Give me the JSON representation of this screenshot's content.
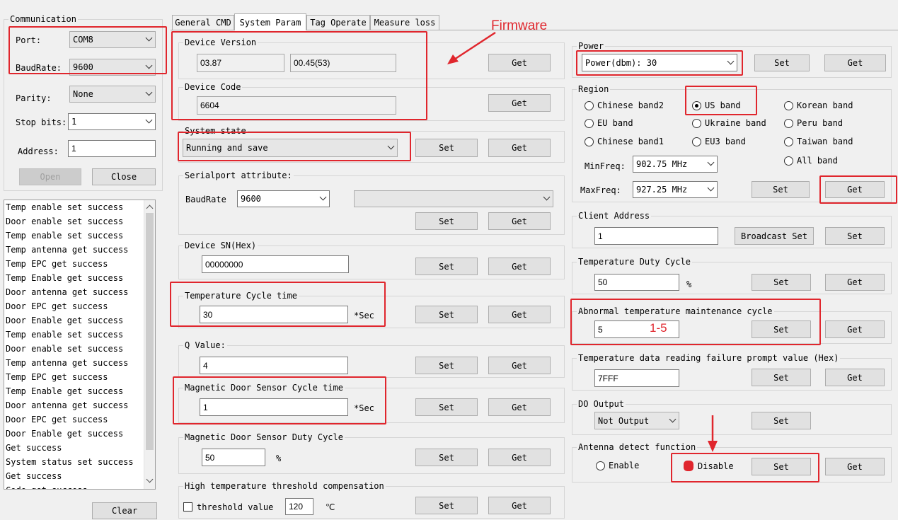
{
  "communication": {
    "title": "Communication",
    "port_label": "Port:",
    "port_value": "COM8",
    "baud_label": "BaudRate:",
    "baud_value": "9600",
    "parity_label": "Parity:",
    "parity_value": "None",
    "stopbits_label": "Stop bits:",
    "stopbits_value": "1",
    "address_label": "Address:",
    "address_value": "1",
    "open_label": "Open",
    "close_label": "Close"
  },
  "log": {
    "lines": [
      "Temp enable set success",
      "Door enable set success",
      "Temp enable set success",
      "Temp antenna get success",
      "Temp EPC get success",
      "Temp Enable get success",
      "Door antenna get success",
      "Door EPC get success",
      "Door Enable get success",
      "Temp enable set success",
      "Door enable set success",
      "Temp antenna get success",
      "Temp EPC get success",
      "Temp Enable get success",
      "Door antenna get success",
      "Door EPC get success",
      "Door Enable get success",
      "Get success",
      "System status set success",
      "Get success",
      "Code get success"
    ],
    "clear_label": "Clear"
  },
  "tabs": [
    "General CMD",
    "System Param",
    "Tag Operate",
    "Measure loss"
  ],
  "params": {
    "device_version": {
      "title": "Device Version",
      "value1": "03.87",
      "value2": "00.45(53)",
      "get": "Get"
    },
    "device_code": {
      "title": "Device Code",
      "value": "6604",
      "get": "Get"
    },
    "system_state": {
      "title": "System state",
      "value": "Running and save",
      "set": "Set",
      "get": "Get"
    },
    "serialport": {
      "title": "Serialport attribute:",
      "baud_label": "BaudRate",
      "baud_value": "9600",
      "other_value": "",
      "set": "Set",
      "get": "Get"
    },
    "device_sn": {
      "title": "Device SN(Hex)",
      "value": "00000000",
      "set": "Set",
      "get": "Get"
    },
    "temp_cycle": {
      "title": "Temperature Cycle time",
      "value": "30",
      "unit": "*Sec",
      "set": "Set",
      "get": "Get"
    },
    "q_value": {
      "title": "Q Value:",
      "value": "4",
      "set": "Set",
      "get": "Get"
    },
    "door_cycle": {
      "title": "Magnetic Door Sensor Cycle time",
      "value": "1",
      "unit": "*Sec",
      "set": "Set",
      "get": "Get"
    },
    "door_duty": {
      "title": "Magnetic Door Sensor Duty Cycle",
      "value": "50",
      "unit": "%",
      "set": "Set",
      "get": "Get"
    },
    "high_temp": {
      "title": "High temperature threshold compensation",
      "check_label": "threshold value",
      "value": "120",
      "unit": "℃",
      "set": "Set",
      "get": "Get"
    }
  },
  "right": {
    "power": {
      "title": "Power",
      "label": "Power(dbm):",
      "value": "30",
      "set": "Set",
      "get": "Get"
    },
    "region": {
      "title": "Region",
      "bands": [
        "Chinese band2",
        "US band",
        "Korean band",
        "EU band",
        "Ukraine band",
        "Peru band",
        "Chinese band1",
        "EU3 band",
        "Taiwan band",
        "All band"
      ],
      "selected": "US band",
      "minfreq_label": "MinFreq:",
      "minfreq_value": "902.75 MHz",
      "maxfreq_label": "MaxFreq:",
      "maxfreq_value": "927.25 MHz",
      "set": "Set",
      "get": "Get"
    },
    "client_address": {
      "title": "Client Address",
      "value": "1",
      "broadcast": "Broadcast Set",
      "set": "Set"
    },
    "temp_duty": {
      "title": "Temperature Duty Cycle",
      "value": "50",
      "unit": "%",
      "set": "Set",
      "get": "Get"
    },
    "abnormal": {
      "title": "Abnormal temperature maintenance cycle",
      "value": "5",
      "set": "Set",
      "get": "Get"
    },
    "temp_fail": {
      "title": "Temperature data reading failure prompt value (Hex)",
      "value": "7FFF",
      "set": "Set",
      "get": "Get"
    },
    "do_output": {
      "title": "DO Output",
      "value": "Not Output",
      "set": "Set"
    },
    "antenna": {
      "title": "Antenna detect function",
      "enable": "Enable",
      "disable": "Disable",
      "set": "Set",
      "get": "Get"
    }
  },
  "annotations": {
    "firmware": "Firmware",
    "range": "1-5",
    "color": "#e0262d"
  }
}
